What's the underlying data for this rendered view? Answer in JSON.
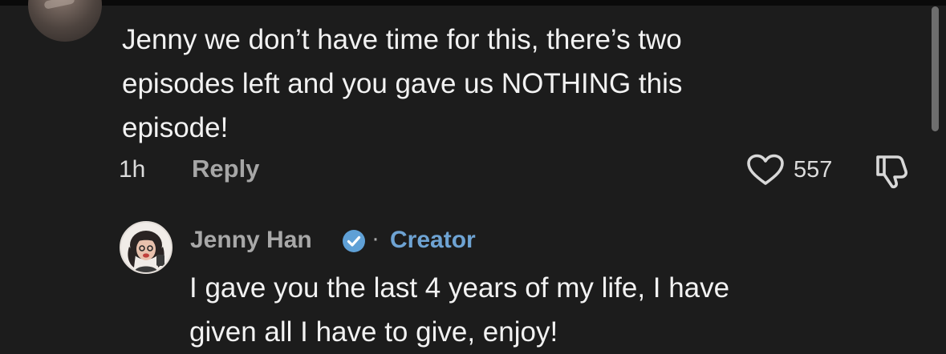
{
  "comment": {
    "lines": [
      "Jenny we don’t have time for this, there’s two",
      "episodes left and you gave us NOTHING this",
      "episode!"
    ],
    "time": "1h",
    "reply_label": "Reply",
    "like_count": "557",
    "icons": {
      "like": "heart-outline-icon",
      "dislike": "thumbs-down-outline-icon"
    }
  },
  "reply": {
    "author": "Jenny Han",
    "separator": "·",
    "badge": "Creator",
    "lines": [
      "I gave you the last 4 years of my life, I have",
      "given all I have to give, enjoy!"
    ],
    "icons": {
      "verified": "verified-check-icon"
    }
  },
  "colors": {
    "background": "#1c1c1c",
    "text": "#f2f2f2",
    "muted": "#a6a6a6",
    "accent": "#6ea3d3",
    "verified": "#5fa0d6"
  }
}
